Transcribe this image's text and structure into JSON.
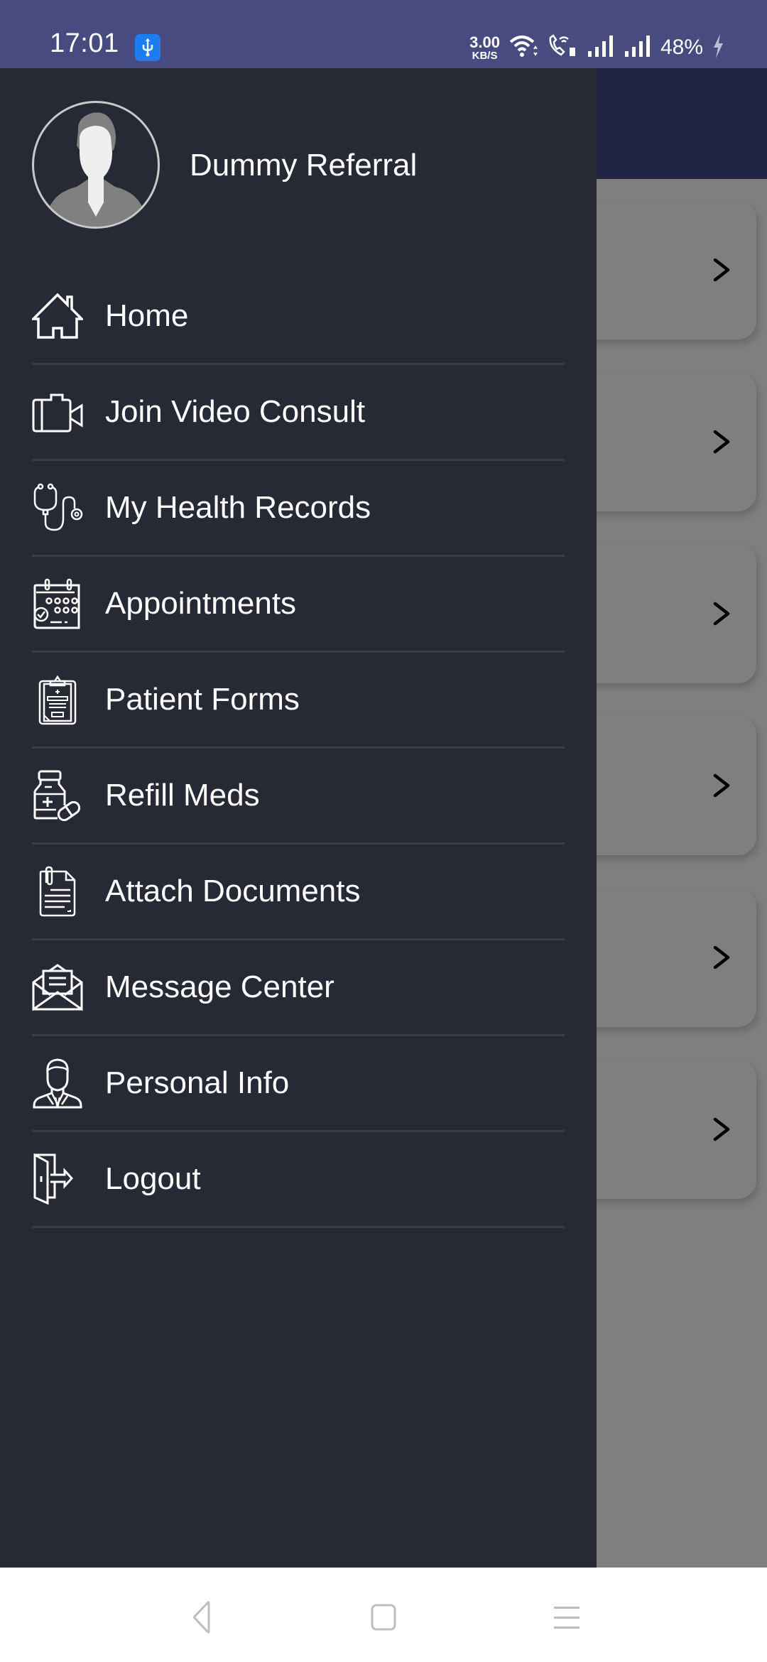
{
  "status_bar": {
    "time": "17:01",
    "net_speed_value": "3.00",
    "net_speed_unit": "KB/S",
    "battery": "48%",
    "icons": [
      "usb-icon",
      "wifi-icon",
      "wifi-calling-icon",
      "signal-icon",
      "signal-icon",
      "charging-icon"
    ]
  },
  "drawer": {
    "user_name": "Dummy Referral",
    "avatar_icon": "default-avatar-icon",
    "menu": [
      {
        "label": "Home",
        "icon": "home-icon"
      },
      {
        "label": "Join Video Consult",
        "icon": "video-camera-icon"
      },
      {
        "label": "My Health Records",
        "icon": "stethoscope-icon"
      },
      {
        "label": "Appointments",
        "icon": "calendar-check-icon"
      },
      {
        "label": "Patient Forms",
        "icon": "clipboard-icon"
      },
      {
        "label": "Refill Meds",
        "icon": "medicine-bottle-icon"
      },
      {
        "label": "Attach Documents",
        "icon": "attached-document-icon"
      },
      {
        "label": "Message Center",
        "icon": "open-envelope-icon"
      },
      {
        "label": "Personal Info",
        "icon": "person-icon"
      },
      {
        "label": "Logout",
        "icon": "logout-door-icon"
      }
    ]
  },
  "background_app": {
    "cards_count": 6,
    "card_icon": "chevron-right-icon"
  },
  "nav_bar": {
    "buttons": [
      "back",
      "home",
      "recents"
    ]
  },
  "colors": {
    "status_bar": "#474b7f",
    "drawer_bg": "#272935",
    "separator": "#3a3d48",
    "scrim_header": "#202342",
    "scrim_body": "#7f7f7f",
    "usb_badge": "#1a7df0"
  }
}
